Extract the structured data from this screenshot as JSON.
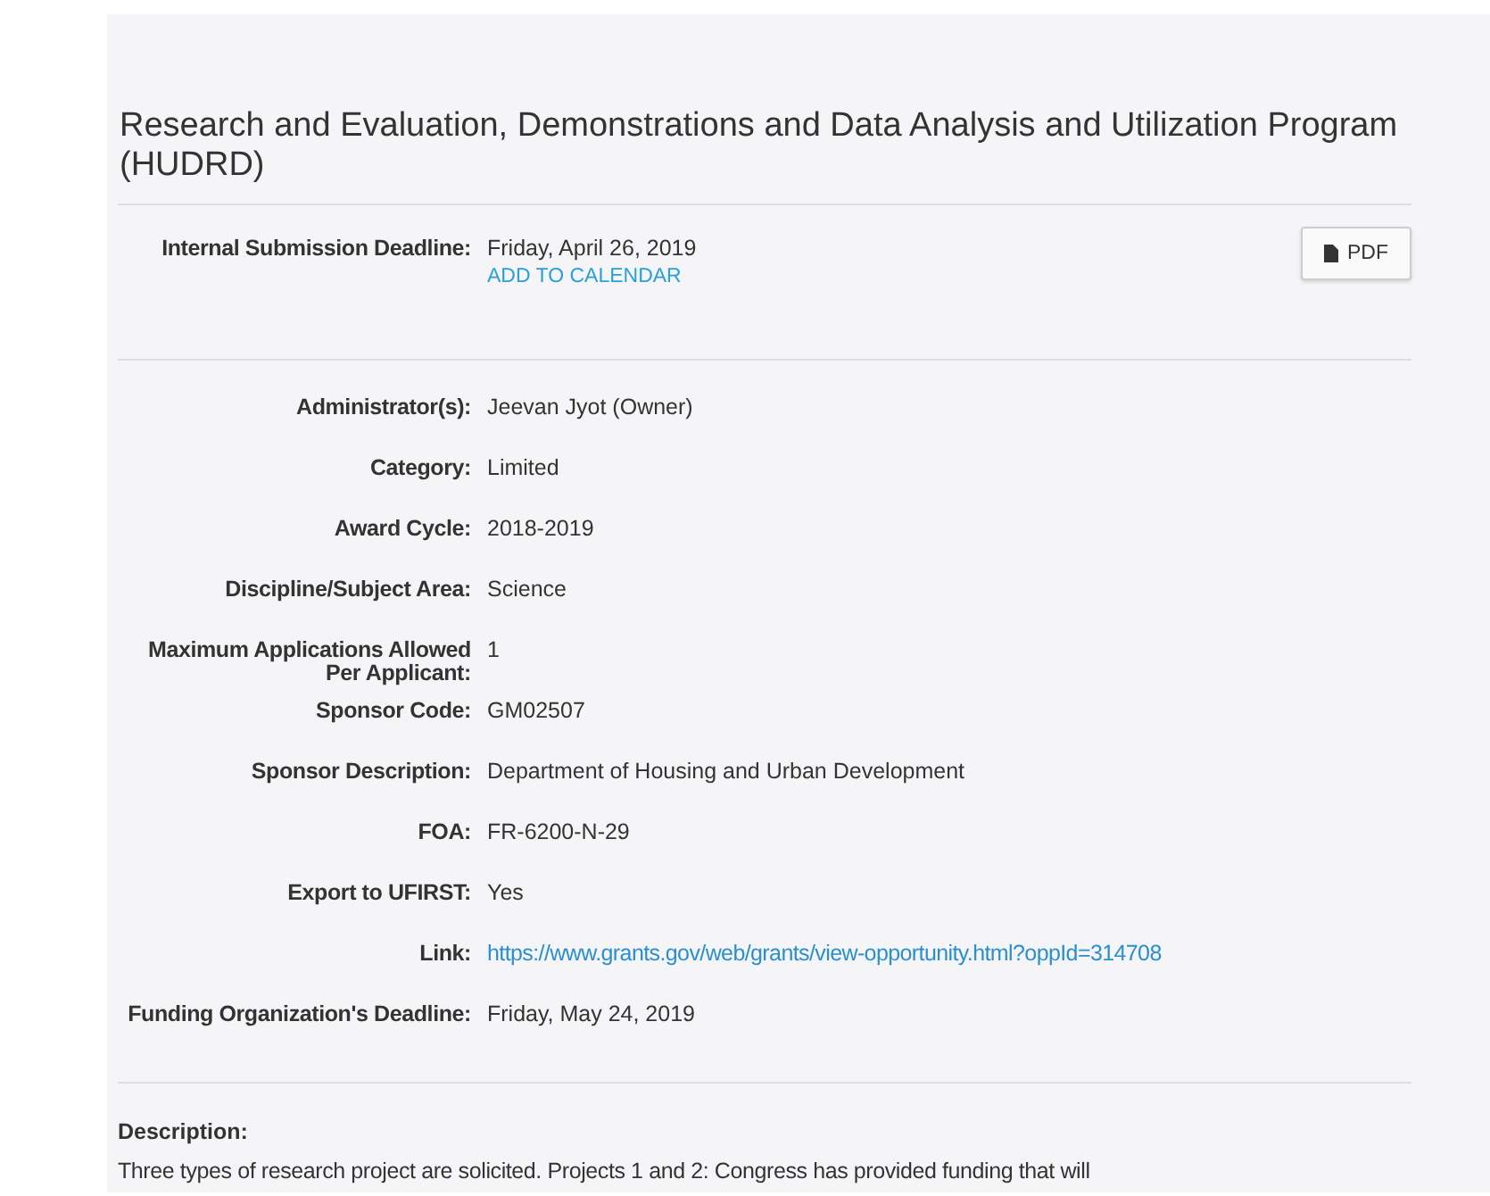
{
  "title": "Research and Evaluation, Demonstrations and Data Analysis and Utilization Program (HUDRD)",
  "deadline": {
    "label": "Internal Submission Deadline:",
    "value": "Friday, April 26, 2019",
    "calendar_link": "ADD TO CALENDAR"
  },
  "pdf_button": "PDF",
  "fields": [
    {
      "label": "Administrator(s):",
      "value": "Jeevan Jyot (Owner)",
      "kind": "text"
    },
    {
      "label": "Category:",
      "value": "Limited",
      "kind": "text"
    },
    {
      "label": "Award Cycle:",
      "value": "2018-2019",
      "kind": "text"
    },
    {
      "label": "Discipline/Subject Area:",
      "value": "Science",
      "kind": "text"
    },
    {
      "label": "Maximum Applications Allowed Per Applicant:",
      "value": "1",
      "kind": "text"
    },
    {
      "label": "Sponsor Code:",
      "value": "GM02507",
      "kind": "text"
    },
    {
      "label": "Sponsor Description:",
      "value": "Department of Housing and Urban Development",
      "kind": "text"
    },
    {
      "label": "FOA:",
      "value": "FR-6200-N-29",
      "kind": "text"
    },
    {
      "label": "Export to UFIRST:",
      "value": "Yes",
      "kind": "text"
    },
    {
      "label": "Link:",
      "value": "https://www.grants.gov/web/grants/view-opportunity.html?oppId=314708",
      "kind": "link"
    },
    {
      "label": "Funding Organization's Deadline:",
      "value": "Friday, May 24, 2019",
      "kind": "text"
    }
  ],
  "description": {
    "label": "Description:",
    "text": "Three types of research project are solicited. Projects 1 and 2: Congress has provided funding that will"
  }
}
